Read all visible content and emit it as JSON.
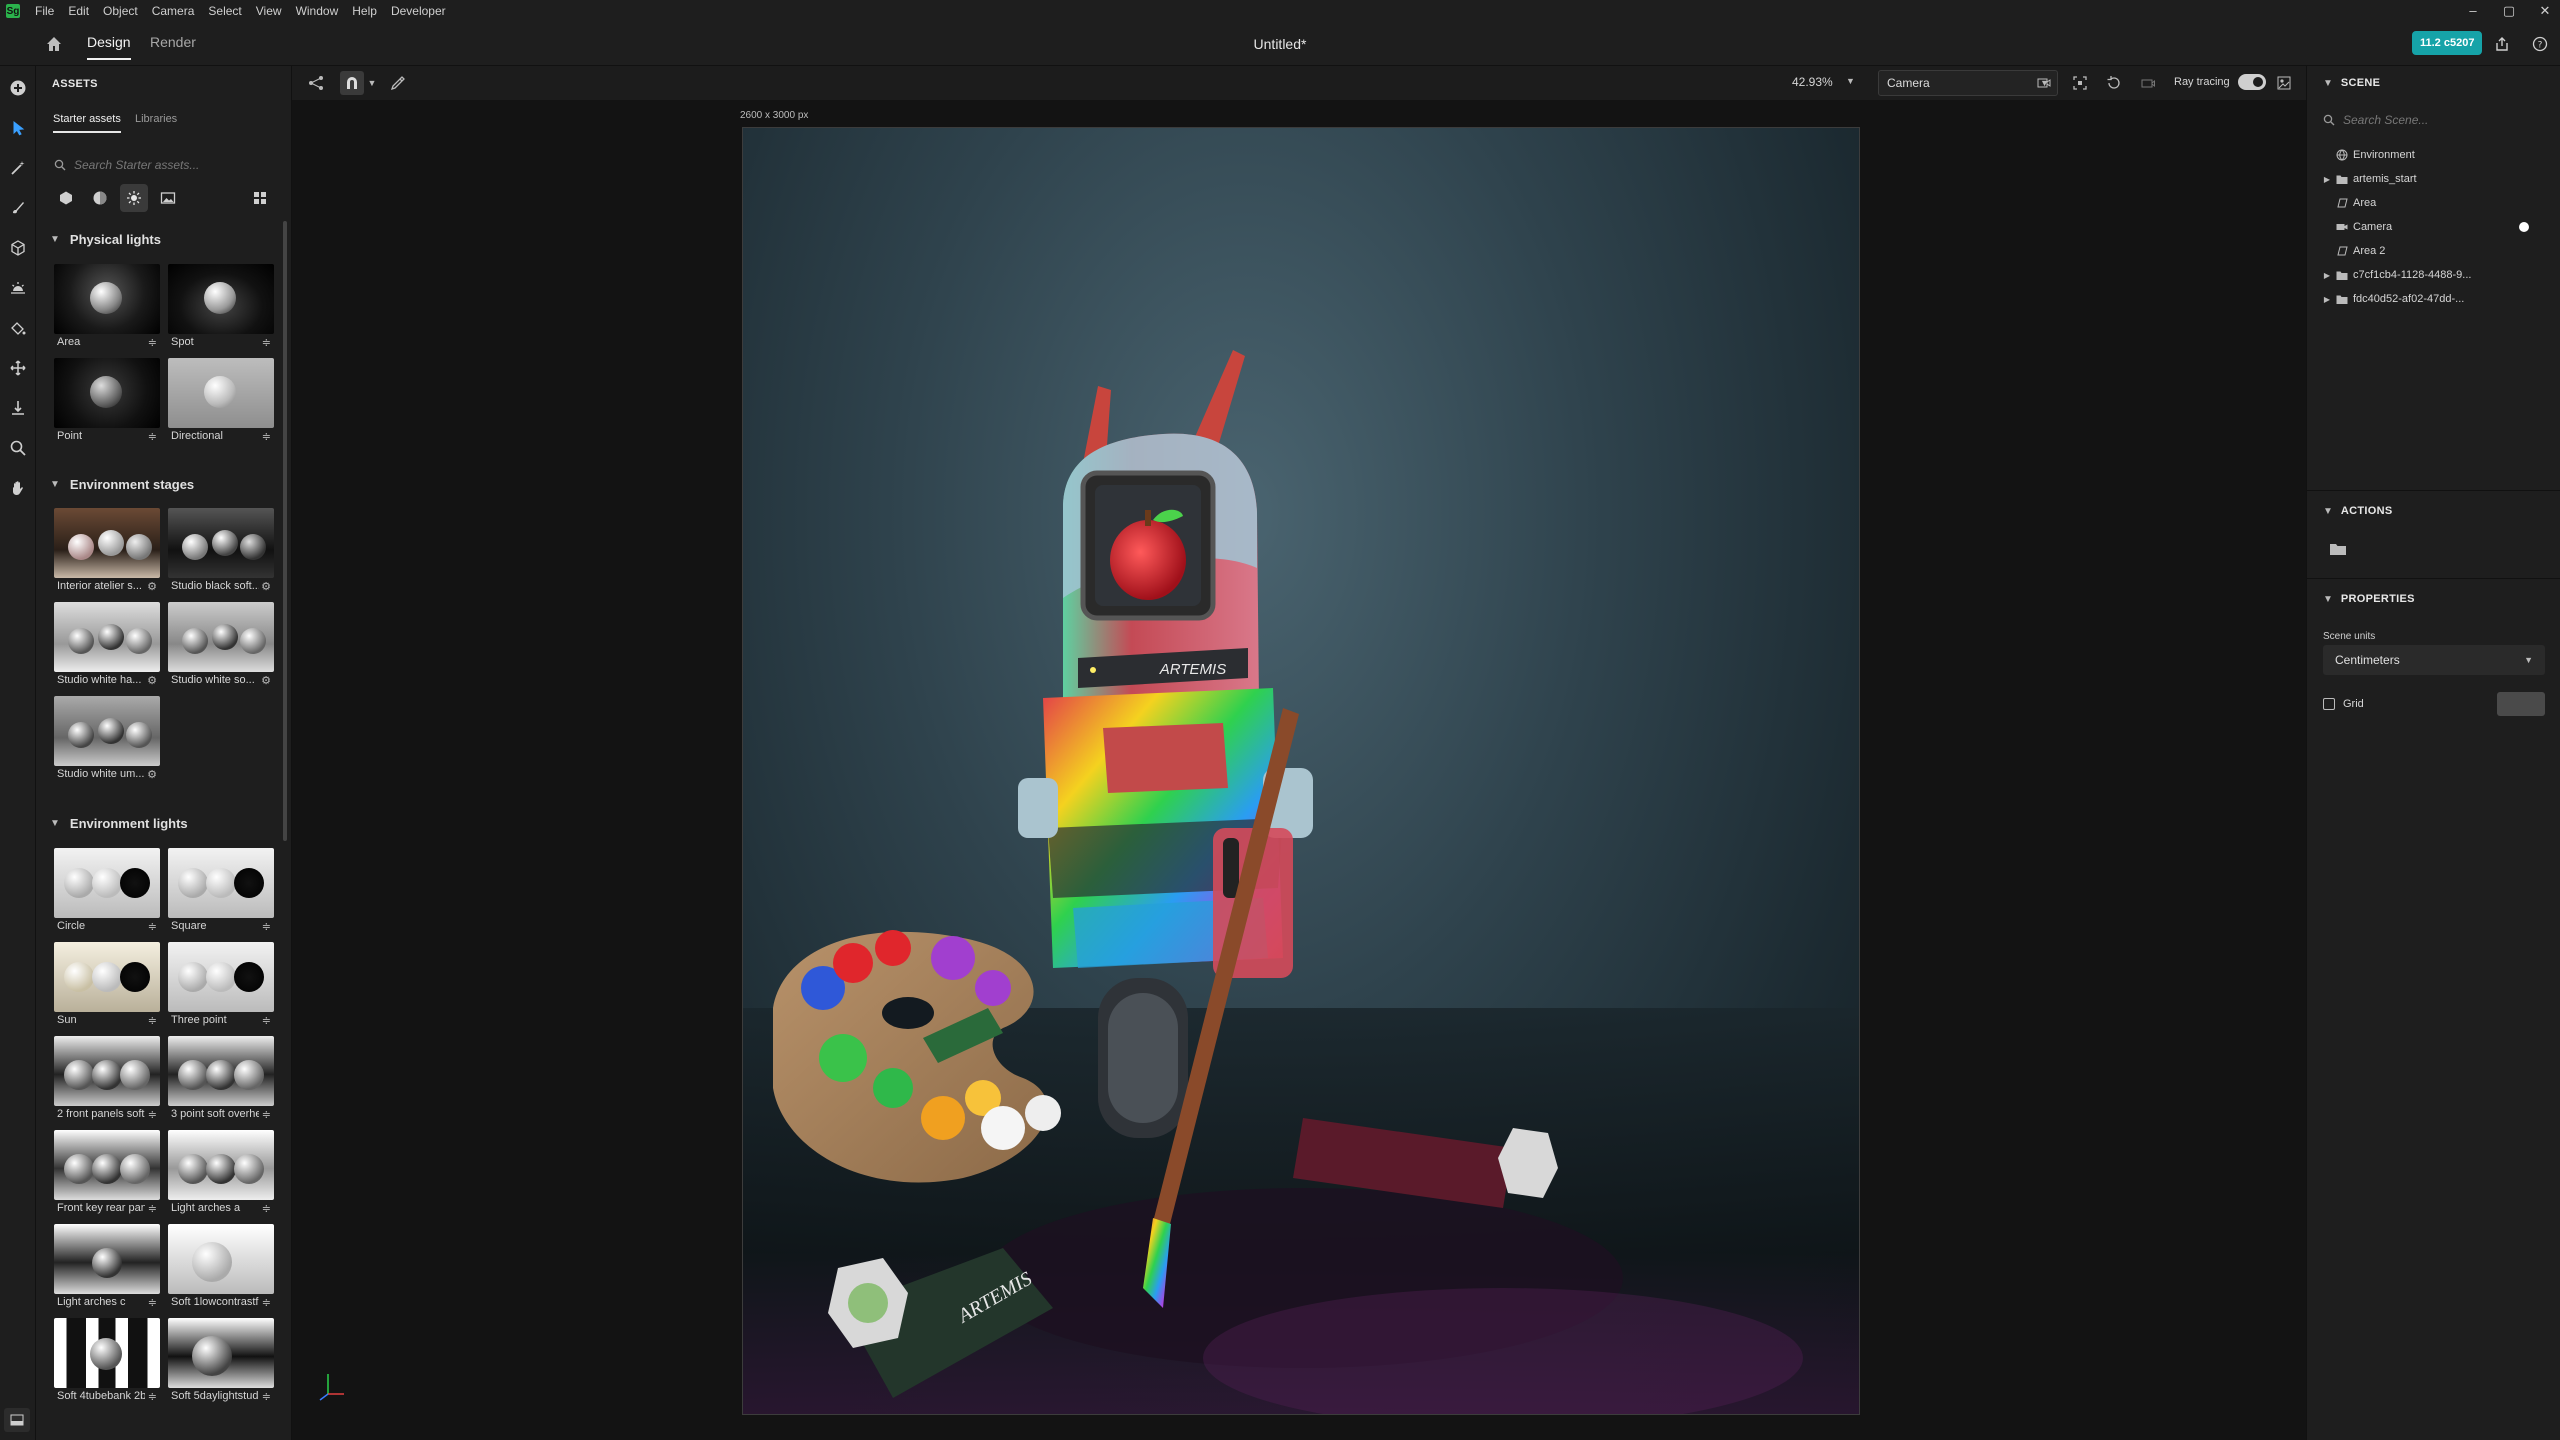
{
  "app": {
    "menu": [
      "File",
      "Edit",
      "Object",
      "Camera",
      "Select",
      "View",
      "Window",
      "Help",
      "Developer"
    ],
    "title": "Untitled*",
    "version_badge": "11.2 c5207",
    "window_controls": [
      "–",
      "▢",
      "✕"
    ]
  },
  "mode_tabs": {
    "design": "Design",
    "render": "Render"
  },
  "assets": {
    "heading": "ASSETS",
    "tabs": {
      "starter": "Starter assets",
      "libraries": "Libraries"
    },
    "search_placeholder": "Search Starter assets...",
    "sections": {
      "physical_lights": {
        "title": "Physical lights",
        "items": [
          "Area",
          "Spot",
          "Point",
          "Directional"
        ]
      },
      "environment_stages": {
        "title": "Environment stages",
        "items": [
          "Interior atelier s...",
          "Studio black soft...",
          "Studio white ha...",
          "Studio white so...",
          "Studio white um..."
        ]
      },
      "environment_lights": {
        "title": "Environment lights",
        "items": [
          "Circle",
          "Square",
          "Sun",
          "Three point",
          "2 front panels soft ...",
          "3 point soft overhe...",
          "Front key rear pan...",
          "Light arches a",
          "Light arches c",
          "Soft 1lowcontrastfr...",
          "Soft 4tubebank 2b...",
          "Soft 5daylightstudio"
        ]
      }
    }
  },
  "viewport": {
    "zoom": "42.93%",
    "camera": "Camera",
    "ray_tracing_label": "Ray tracing",
    "ray_tracing_on": true,
    "canvas_size": "2600 x 3000 px",
    "robot_brand": "ARTEMIS",
    "paint_tube_text": "ARTEMIS"
  },
  "scene": {
    "heading": "SCENE",
    "search_placeholder": "Search Scene...",
    "items": [
      {
        "label": "Environment",
        "icon": "globe-icon",
        "expandable": false
      },
      {
        "label": "artemis_start",
        "icon": "folder-icon",
        "expandable": true
      },
      {
        "label": "Area",
        "icon": "area-light-icon",
        "expandable": false
      },
      {
        "label": "Camera",
        "icon": "camera-icon",
        "expandable": false
      },
      {
        "label": "Area 2",
        "icon": "area-light-icon",
        "expandable": false
      },
      {
        "label": "c7cf1cb4-1128-4488-9...",
        "icon": "folder-icon",
        "expandable": true
      },
      {
        "label": "fdc40d52-af02-47dd-...",
        "icon": "folder-icon",
        "expandable": true
      }
    ]
  },
  "actions": {
    "heading": "ACTIONS"
  },
  "properties": {
    "heading": "PROPERTIES",
    "scene_units_label": "Scene units",
    "scene_units_value": "Centimeters",
    "grid_label": "Grid",
    "grid_checked": false
  },
  "colors": {
    "accent": "#16a3a8",
    "selection_blue": "#3aa0ff",
    "panel_bg": "#1e1e1e",
    "canvas_bg": "#131313"
  }
}
